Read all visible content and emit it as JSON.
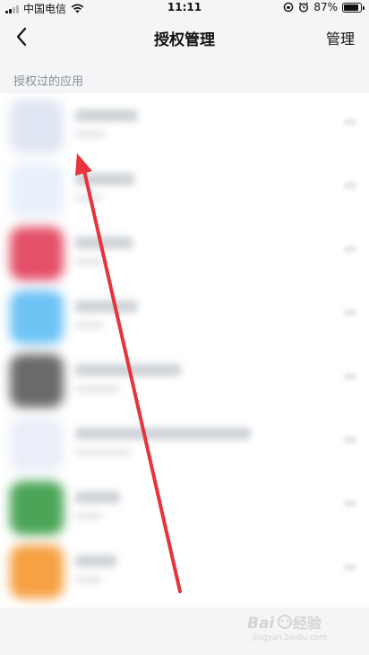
{
  "status_bar": {
    "carrier": "中国电信",
    "time": "11:11",
    "battery_percent": "87%",
    "battery_level": 0.87
  },
  "nav": {
    "title": "授权管理",
    "manage_label": "管理"
  },
  "section": {
    "label": "授权过的应用"
  },
  "apps": [
    {
      "icon_color": "#dfe5f2"
    },
    {
      "icon_color": "#e8f0fb"
    },
    {
      "icon_color": "#e45068"
    },
    {
      "icon_color": "#6ec3f5"
    },
    {
      "icon_color": "#6a6a6a"
    },
    {
      "icon_color": "#e9eef8"
    },
    {
      "icon_color": "#4aa556"
    },
    {
      "icon_color": "#f6a143"
    }
  ],
  "annotation": {
    "color": "#e8323c"
  },
  "watermark": {
    "text": "jingyan.baidu.com"
  }
}
